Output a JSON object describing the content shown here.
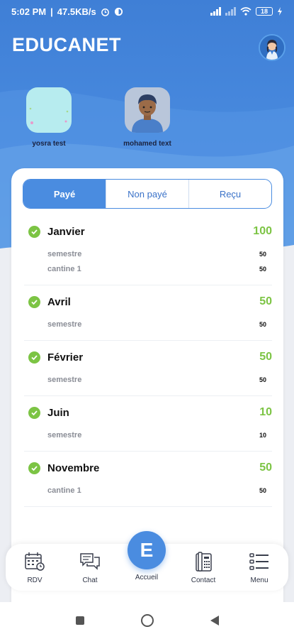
{
  "status_bar": {
    "time": "5:02 PM",
    "speed": "47.5KB/s",
    "separator": "|",
    "battery": "18"
  },
  "app": {
    "title": "EDUCANET"
  },
  "children": [
    {
      "name": "yosra test"
    },
    {
      "name": "mohamed text"
    }
  ],
  "tabs": [
    {
      "label": "Payé",
      "active": true
    },
    {
      "label": "Non payé",
      "active": false
    },
    {
      "label": "Reçu",
      "active": false
    }
  ],
  "months": [
    {
      "name": "Janvier",
      "total": "100",
      "lines": [
        {
          "label": "semestre",
          "amount": "50"
        },
        {
          "label": "cantine 1",
          "amount": "50"
        }
      ]
    },
    {
      "name": "Avril",
      "total": "50",
      "lines": [
        {
          "label": "semestre",
          "amount": "50"
        }
      ]
    },
    {
      "name": "Février",
      "total": "50",
      "lines": [
        {
          "label": "semestre",
          "amount": "50"
        }
      ]
    },
    {
      "name": "Juin",
      "total": "10",
      "lines": [
        {
          "label": "semestre",
          "amount": "10"
        }
      ]
    },
    {
      "name": "Novembre",
      "total": "50",
      "lines": [
        {
          "label": "cantine 1",
          "amount": "50"
        }
      ]
    }
  ],
  "bottom_nav": {
    "rdv": "RDV",
    "chat": "Chat",
    "home": "Accueil",
    "home_letter": "E",
    "contact": "Contact",
    "menu": "Menu"
  },
  "colors": {
    "primary": "#4a8ce0",
    "paid_green": "#7cc444",
    "text_dark": "#111111",
    "muted": "#8a8d96"
  },
  "icons": [
    "alarm-icon",
    "app-icon",
    "signal-icon",
    "wifi-icon",
    "battery-icon",
    "check-icon",
    "calendar-icon",
    "chat-icon",
    "phone-icon",
    "menu-icon"
  ]
}
